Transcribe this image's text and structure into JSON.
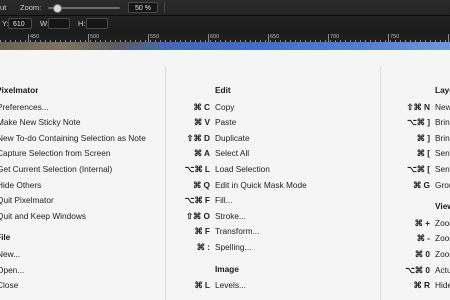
{
  "toolbar": {
    "cut_label": "ut",
    "zoom_label": "Zoom:",
    "zoom_value": "50 %",
    "zoom_level": 0.12,
    "y_label": "Y:",
    "y_value": "610",
    "w_label": "W:",
    "h_label": "H:"
  },
  "ruler": {
    "labels": [
      "450",
      "500",
      "550",
      "600",
      "650",
      "700",
      "750",
      "800"
    ]
  },
  "columns": [
    {
      "sections": [
        {
          "heading": "Pixelmator",
          "items": [
            {
              "shortcut": "",
              "label": "Preferences..."
            },
            {
              "shortcut": "",
              "label": "Make New Sticky Note"
            },
            {
              "shortcut": "",
              "label": "New To-do Containing Selection as Note"
            },
            {
              "shortcut": "",
              "label": "Capture Selection from Screen"
            },
            {
              "shortcut": "",
              "label": "Get Current Selection (Internal)"
            },
            {
              "shortcut": "",
              "label": "Hide Others"
            },
            {
              "shortcut": "",
              "label": "Quit Pixelmator"
            },
            {
              "shortcut": "",
              "label": "Quit and Keep Windows"
            }
          ]
        },
        {
          "heading": "File",
          "items": [
            {
              "shortcut": "",
              "label": "New..."
            },
            {
              "shortcut": "",
              "label": "Open..."
            },
            {
              "shortcut": "",
              "label": "Close"
            }
          ]
        }
      ]
    },
    {
      "sections": [
        {
          "heading": "Edit",
          "items": [
            {
              "shortcut": "⌘ C",
              "label": "Copy"
            },
            {
              "shortcut": "⌘ V",
              "label": "Paste"
            },
            {
              "shortcut": "⇧⌘ D",
              "label": "Duplicate"
            },
            {
              "shortcut": "⌘ A",
              "label": "Select All"
            },
            {
              "shortcut": "⌥⌘ L",
              "label": "Load Selection"
            },
            {
              "shortcut": "⌘ Q",
              "label": "Edit in Quick Mask Mode"
            },
            {
              "shortcut": "⌥⌘ F",
              "label": "Fill..."
            },
            {
              "shortcut": "⇧⌘ O",
              "label": "Stroke..."
            },
            {
              "shortcut": "⌘ F",
              "label": "Transform..."
            },
            {
              "shortcut": "⌘ :",
              "label": "Spelling..."
            }
          ]
        },
        {
          "heading": "Image",
          "items": [
            {
              "shortcut": "⌘ L",
              "label": "Levels..."
            }
          ]
        }
      ]
    },
    {
      "sections": [
        {
          "heading": "Layer",
          "items": [
            {
              "shortcut": "⇧⌘ N",
              "label": "New Layer"
            },
            {
              "shortcut": "⌥⌘ ]",
              "label": "Bring Forward"
            },
            {
              "shortcut": "⌘ ]",
              "label": "Bring to Front"
            },
            {
              "shortcut": "⌘ [",
              "label": "Send Backward"
            },
            {
              "shortcut": "⌥⌘ [",
              "label": "Send to Back"
            },
            {
              "shortcut": "⌘ G",
              "label": "Group Layers"
            }
          ]
        },
        {
          "heading": "View",
          "items": [
            {
              "shortcut": "⌘ +",
              "label": "Zoom In"
            },
            {
              "shortcut": "⌘ -",
              "label": "Zoom Out"
            },
            {
              "shortcut": "⌘ 0",
              "label": "Zoom to Fit"
            },
            {
              "shortcut": "⌥⌘ 0",
              "label": "Actual Size"
            },
            {
              "shortcut": "⌘ R",
              "label": "Hide Rulers"
            }
          ]
        }
      ]
    }
  ]
}
